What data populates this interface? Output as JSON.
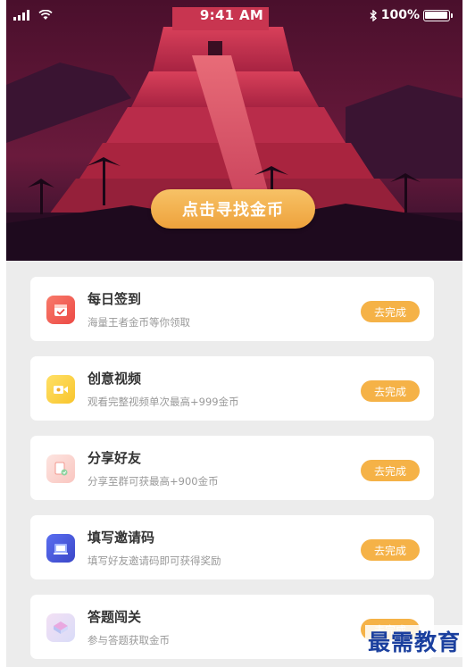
{
  "status_bar": {
    "time": "9:41 AM",
    "battery_text": "100%",
    "icons": [
      "signal-icon",
      "wifi-icon",
      "bluetooth-icon",
      "battery-icon"
    ]
  },
  "hero": {
    "button_label": "点击寻找金币",
    "colors": {
      "sky": "#3a1230",
      "pyramid": "#c7304c",
      "button": "#f2ac4c"
    }
  },
  "tasks": [
    {
      "title": "每日签到",
      "desc": "海量王者金币等你领取",
      "button": "去完成",
      "icon": "calendar-checkin-icon"
    },
    {
      "title": "创意视频",
      "desc": "观看完整视频单次最高+999金币",
      "button": "去完成",
      "icon": "video-icon"
    },
    {
      "title": "分享好友",
      "desc": "分享至群可获最高+900金币",
      "button": "去完成",
      "icon": "share-icon"
    },
    {
      "title": "填写邀请码",
      "desc": "填写好友邀请码即可获得奖励",
      "button": "去完成",
      "icon": "invite-code-icon"
    },
    {
      "title": "答题闯关",
      "desc": "参与答题获取金币",
      "button": "去完成",
      "icon": "quiz-icon"
    }
  ],
  "watermark": "最需教育",
  "accent_color": "#f5b247"
}
